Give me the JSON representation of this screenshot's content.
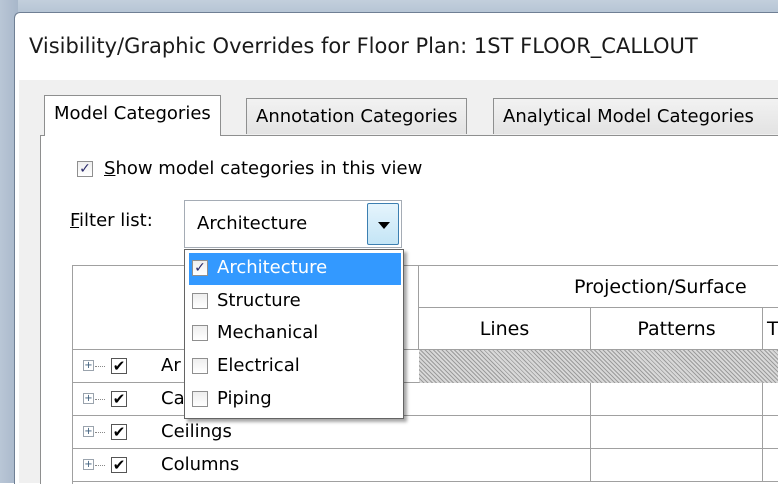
{
  "window": {
    "title": "Visibility/Graphic Overrides for Floor Plan: 1ST FLOOR_CALLOUT"
  },
  "tabs": [
    {
      "label": "Model Categories",
      "active": true
    },
    {
      "label": "Annotation Categories",
      "active": false
    },
    {
      "label": "Analytical Model Categories",
      "active": false
    }
  ],
  "show_model": {
    "label_accel": "S",
    "label_rest": "how model categories in this view",
    "checked": true
  },
  "filter": {
    "label_accel": "F",
    "label_rest": "ilter list:",
    "value": "Architecture"
  },
  "dropdown": {
    "items": [
      {
        "label": "Architecture",
        "checked": true,
        "selected": true
      },
      {
        "label": "Structure",
        "checked": false,
        "selected": false
      },
      {
        "label": "Mechanical",
        "checked": false,
        "selected": false
      },
      {
        "label": "Electrical",
        "checked": false,
        "selected": false
      },
      {
        "label": "Piping",
        "checked": false,
        "selected": false
      }
    ]
  },
  "grid": {
    "group_header": "Projection/Surface",
    "columns": [
      "Lines",
      "Patterns",
      "T"
    ],
    "rows": [
      {
        "text": "Ar",
        "checked": true
      },
      {
        "text": "Ca",
        "checked": true
      },
      {
        "text": "Ceilings",
        "checked": true
      },
      {
        "text": "Columns",
        "checked": true
      }
    ],
    "check_glyph": "✔",
    "expand_glyph": "+"
  },
  "colors": {
    "selection": "#3399ff",
    "frame": "#b3c2d3",
    "grid_lines": "#a0a0a0"
  }
}
